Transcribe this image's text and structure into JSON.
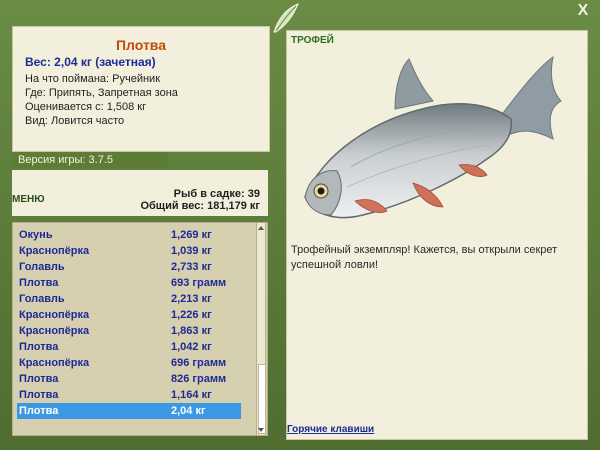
{
  "window": {
    "close_label": "X"
  },
  "fish": {
    "name": "Плотва",
    "weight_line": "Вес: 2,04 кг (зачетная)",
    "details": [
      "На что поймана: Ручейник",
      "Где: Припять, Запретная зона",
      "Оценивается с: 1,508 кг",
      "Вид: Ловится часто"
    ]
  },
  "version_label": "Версия игры: 3.7.5",
  "menu_label": "МЕНЮ",
  "stats": {
    "count_line": "Рыб в садке: 39",
    "total_line": "Общий вес: 181,179 кг"
  },
  "catch_list": [
    {
      "name": "Окунь",
      "weight": "1,269 кг"
    },
    {
      "name": "Краснопёрка",
      "weight": "1,039 кг"
    },
    {
      "name": "Голавль",
      "weight": "2,733 кг"
    },
    {
      "name": "Плотва",
      "weight": "693 грамм"
    },
    {
      "name": "Голавль",
      "weight": "2,213 кг"
    },
    {
      "name": "Краснопёрка",
      "weight": "1,226 кг"
    },
    {
      "name": "Краснопёрка",
      "weight": "1,863 кг"
    },
    {
      "name": "Плотва",
      "weight": "1,042 кг"
    },
    {
      "name": "Краснопёрка",
      "weight": "696 грамм"
    },
    {
      "name": "Плотва",
      "weight": "826 грамм"
    },
    {
      "name": "Плотва",
      "weight": "1,164 кг"
    },
    {
      "name": "Плотва",
      "weight": "2,04 кг"
    }
  ],
  "trophy": {
    "label": "ТРОФЕЙ",
    "text": "Трофейный экземпляр! Кажется, вы открыли секрет успешной ловли!",
    "hotkeys_label": "Горячие клавиши"
  },
  "colors": {
    "frame_green": "#5b7a3a",
    "panel_cream": "#f2f0dc",
    "list_bg": "#d6d0b0",
    "selected_blue": "#3b99e3",
    "name_orange": "#c24a0b",
    "text_blue": "#1c2a95"
  },
  "icons": [
    "close-icon",
    "leaf-emblem-icon"
  ]
}
